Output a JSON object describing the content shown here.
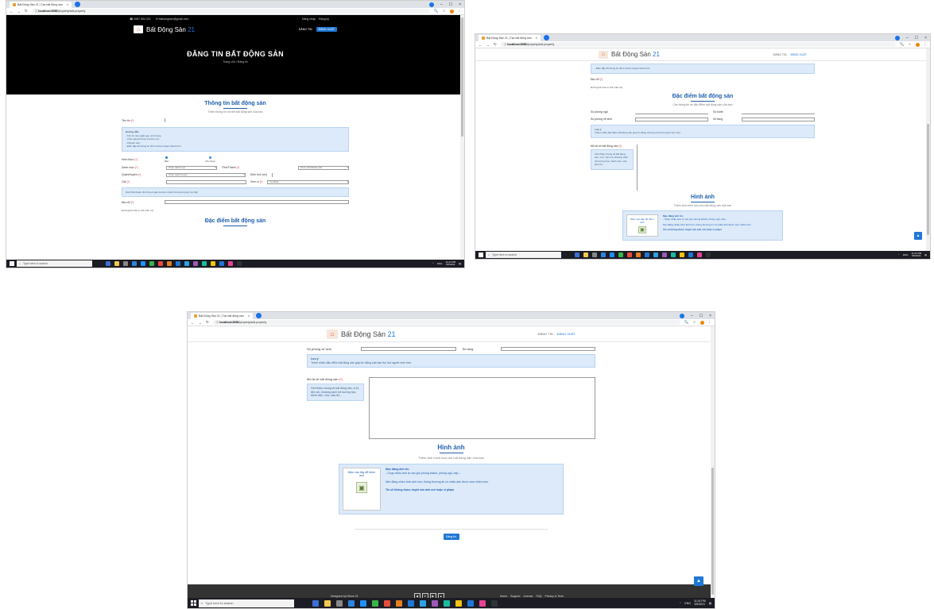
{
  "browser": {
    "tab_title": "Bất Động Sản 21 | Tạo bất động sản",
    "tab_close": "×",
    "url_host": "localhost:8080",
    "url_path": "/property/add-property",
    "win_min": "–",
    "win_max": "☐",
    "win_close": "×",
    "back": "←",
    "forward": "→",
    "reload": "↻",
    "info": "ⓘ",
    "search": "🔍",
    "star": "☆",
    "menu": "⋮"
  },
  "taskbar": {
    "search_placeholder": "Type here to search",
    "language": "ENG",
    "time": "11:24 PM",
    "date": "5/5/2021",
    "icon_colors": [
      "#3b6fd6",
      "#f2c94c",
      "#888888",
      "#2c83e0",
      "#1e90ff",
      "#39b54a",
      "#e74c3c",
      "#e67e22",
      "#1f77d6",
      "#2da1e6",
      "#9b59b6",
      "#1abc9c",
      "#f1c40f",
      "#1f77d6",
      "#e84393",
      "#2d3436"
    ]
  },
  "site": {
    "logo_icon": "⌂",
    "logo_text": "Bất Động Sản ",
    "logo_num": "21",
    "top_phone": "☎ 0987 654 321",
    "top_email": "✉ batdongsan@gmail.com",
    "top_login": "Đăng nhập",
    "top_register": "Đăng ký",
    "nav_post": "ĐĂNG TIN",
    "nav_account": "ĐĂNG XUẤT",
    "hero_title": "ĐĂNG TIN BẤT ĐỘNG SẢN",
    "hero_crumb": "Trang chủ / Đăng tin"
  },
  "form": {
    "info_title": "Thông tin bất động sản",
    "info_sub": "Thêm thông tin chi tiết bất động sản của bạn",
    "name_label": "Tên tin",
    "req": "(*)",
    "note_lines": [
      "Hướng dẫn:",
      "- Tên tin nên ngắn gọn và rõ ràng",
      "- Chọn giá phù hợp với khu vực",
      "- Khuyến cáo:",
      "- Điền đầy đủ thông tin để tin được duyệt nhanh hơn"
    ],
    "type_label": "Hình thức",
    "radio_sell": "Bán",
    "radio_rent": "Cho thuê",
    "field_category": "Danh mục",
    "field_category_val": "Chọn danh mục",
    "field_city": "Tỉnh/Thành",
    "field_city_val": "Chọn tỉnh/thành phố",
    "field_district": "Quận/Huyện",
    "field_district_val": "Chọn quận huyện",
    "field_area": "Diện tích (m²)",
    "field_price": "Giá",
    "field_unit": "Đơn vị",
    "field_unit_val": "Tỷ đồng",
    "price_note": "Giá thỏa thuận: để trống ô giá nếu bạn muốn thương lượng trực tiếp",
    "address_label": "Địa chỉ",
    "address_hint": "Đường/số nhà cụ thể (nếu có)",
    "features_title": "Đặc điểm bất động sản",
    "features_sub": "Các thông tin về đặc điểm bất động sản của bạn",
    "bedroom_label": "Số phòng ngủ",
    "toilet_label": "Số toilet",
    "bathroom_label": "Số phòng vệ sinh",
    "floor_label": "Số tầng",
    "note2_title": "Lưu ý",
    "note2_text": "Thêm nhiều đặc điểm bất động sản giúp tin đăng của bạn thu hút người xem hơn.",
    "desc_label": "Mô tả về bất động sản",
    "desc_hint": "Giới thiệu chung về bất động sản, vị trí, tiện ích, khoảng cách tới trường học, bệnh viện, chợ, siêu thị...",
    "images_title": "Hình ảnh",
    "images_sub": "Thêm ảnh minh họa cho bất động sản của bạn",
    "upload_box_label": "Bấm vào đây để thêm ảnh",
    "upload_icon": "▣",
    "upload_tips": [
      "Mẹo đăng ảnh tin:",
      "- Chụp nhiều ảnh từ các góc phòng khách, phòng ngủ, bếp...",
      "Nên đăng nhiều hình ảnh hơn, thông thường tin có nhiều ảnh được xem nhiều hơn.",
      "Tin sẽ không được duyệt nếu ảnh mờ hoặc vi phạm"
    ],
    "submit_label": "Đăng tin"
  },
  "footer": {
    "designed": "Designed by Nhóm 21",
    "pager": [
      "◀",
      "▾",
      "▶",
      "▲"
    ],
    "links": [
      "Home",
      "Support",
      "License",
      "FAQ",
      "Privacy & Term"
    ],
    "fab": "▲"
  }
}
